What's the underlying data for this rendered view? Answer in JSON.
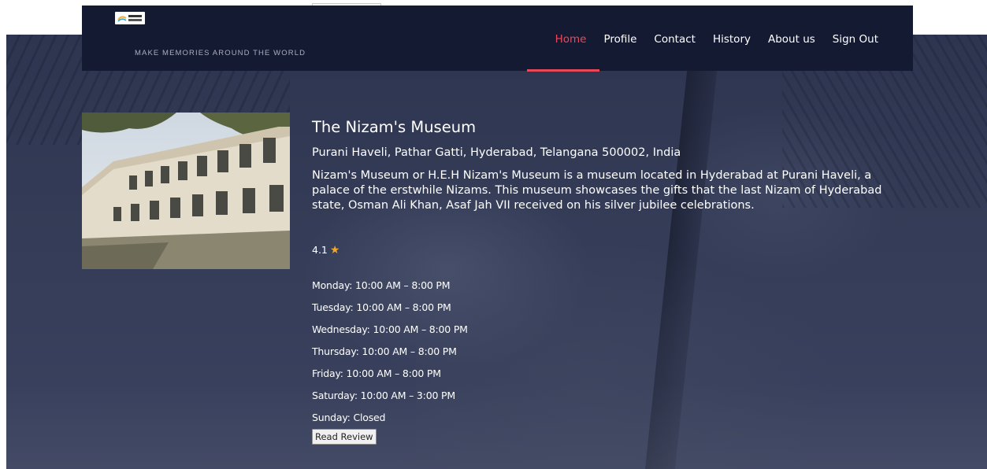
{
  "header": {
    "logo_icon": "travel-explorer-logo",
    "tagline": "MAKE MEMORIES AROUND THE WORLD",
    "nav": [
      {
        "label": "Home",
        "active": true
      },
      {
        "label": "Profile"
      },
      {
        "label": "Contact"
      },
      {
        "label": "History"
      },
      {
        "label": "About us"
      },
      {
        "label": "Sign Out"
      }
    ],
    "accent_color": "#e9485a",
    "background_color": "#151a33"
  },
  "place": {
    "name": "The Nizam's Museum",
    "address": "Purani Haveli, Pathar Gatti, Hyderabad, Telangana 500002, India",
    "description": "Nizam's Museum or H.E.H Nizam's Museum is a museum located in Hyderabad at Purani Haveli, a palace of the erstwhile Nizams. This museum showcases the gifts that the last Nizam of Hyderabad state, Osman Ali Khan, Asaf Jah VII received on his silver jubilee celebrations.",
    "rating": "4.1",
    "rating_icon": "star-icon",
    "hours": [
      "Monday: 10:00 AM – 8:00 PM",
      "Tuesday: 10:00 AM – 8:00 PM",
      "Wednesday: 10:00 AM – 8:00 PM",
      "Thursday: 10:00 AM – 8:00 PM",
      "Friday: 10:00 AM – 8:00 PM",
      "Saturday: 10:00 AM – 3:00 PM",
      "Sunday: Closed"
    ],
    "review_button": "Read Review"
  }
}
